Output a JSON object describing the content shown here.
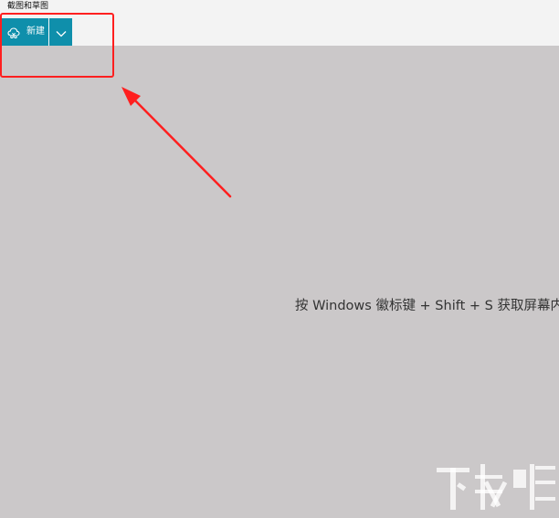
{
  "window": {
    "title": "截图和草图"
  },
  "toolbar": {
    "new_label": "新建",
    "new_icon": "snip-icon",
    "dropdown_icon": "chevron-down-icon",
    "accent_color": "#0f8fab"
  },
  "main": {
    "hint": "按 Windows 徽标键 + Shift + S 获取屏幕内容"
  },
  "annotation": {
    "box_color": "#ff1f1f",
    "arrow_color": "#ff1f1f"
  },
  "watermark": {
    "logo": "下载吧"
  }
}
